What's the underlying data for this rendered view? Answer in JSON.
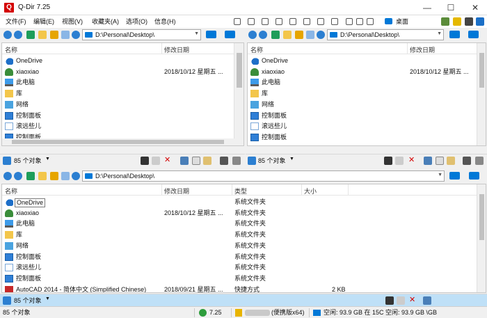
{
  "window": {
    "title": "Q-Dir 7.25",
    "app_icon_glyph": "Q",
    "controls": {
      "minimize": "—",
      "maximize": "☐",
      "close": "✕"
    }
  },
  "menu": [
    "文件(F)",
    "编辑(E)",
    "视图(V)",
    "收藏夹(A)",
    "选项(O)",
    "信息(H)"
  ],
  "menu_right": {
    "desktop_label": "桌面"
  },
  "panes": {
    "top_left": {
      "address": "D:\\Personal\\Desktop\\",
      "columns": [
        "名称",
        "修改日期"
      ],
      "rows": [
        {
          "name": "OneDrive",
          "date": "",
          "icon": "onedrive-icon"
        },
        {
          "name": "xiaoxiao",
          "date": "2018/10/12 星期五 ...",
          "icon": "user-icon"
        },
        {
          "name": "此电脑",
          "date": "",
          "icon": "computer-icon"
        },
        {
          "name": "库",
          "date": "",
          "icon": "library-icon"
        },
        {
          "name": "网络",
          "date": "",
          "icon": "network-icon"
        },
        {
          "name": "控制面板",
          "date": "",
          "icon": "control-panel-icon"
        },
        {
          "name": "滚远些儿",
          "date": "",
          "icon": "sync-icon"
        },
        {
          "name": "控制面板",
          "date": "",
          "icon": "control-panel-icon"
        }
      ],
      "count": "85 个对象"
    },
    "top_right": {
      "address": "D:\\Personal\\Desktop\\",
      "columns": [
        "名称",
        "修改日期"
      ],
      "rows": [
        {
          "name": "OneDrive",
          "date": "",
          "icon": "onedrive-icon"
        },
        {
          "name": "xiaoxiao",
          "date": "2018/10/12 星期五 ...",
          "icon": "user-icon"
        },
        {
          "name": "此电脑",
          "date": "",
          "icon": "computer-icon"
        },
        {
          "name": "库",
          "date": "",
          "icon": "library-icon"
        },
        {
          "name": "网络",
          "date": "",
          "icon": "network-icon"
        },
        {
          "name": "控制面板",
          "date": "",
          "icon": "control-panel-icon"
        },
        {
          "name": "滚远些儿",
          "date": "",
          "icon": "sync-icon"
        },
        {
          "name": "控制面板",
          "date": "",
          "icon": "control-panel-icon"
        }
      ],
      "count": "85 个对象"
    },
    "bottom": {
      "address": "D:\\Personal\\Desktop\\",
      "columns": [
        "名称",
        "修改日期",
        "类型",
        "大小"
      ],
      "rows": [
        {
          "name": "OneDrive",
          "date": "",
          "type": "系统文件夹",
          "size": "",
          "icon": "onedrive-icon"
        },
        {
          "name": "xiaoxiao",
          "date": "2018/10/12 星期五 ...",
          "type": "系统文件夹",
          "size": "",
          "icon": "user-icon"
        },
        {
          "name": "此电脑",
          "date": "",
          "type": "系统文件夹",
          "size": "",
          "icon": "computer-icon"
        },
        {
          "name": "库",
          "date": "",
          "type": "系统文件夹",
          "size": "",
          "icon": "library-icon"
        },
        {
          "name": "网络",
          "date": "",
          "type": "系统文件夹",
          "size": "",
          "icon": "network-icon"
        },
        {
          "name": "控制面板",
          "date": "",
          "type": "系统文件夹",
          "size": "",
          "icon": "control-panel-icon"
        },
        {
          "name": "滚远些儿",
          "date": "",
          "type": "系统文件夹",
          "size": "",
          "icon": "sync-icon"
        },
        {
          "name": "控制面板",
          "date": "",
          "type": "系统文件夹",
          "size": "",
          "icon": "control-panel-icon"
        },
        {
          "name": "AutoCAD 2014 - 简体中文 (Simplified Chinese)",
          "date": "2018/09/21 星期五 ...",
          "type": "快捷方式",
          "size": "2 KB",
          "icon": "autocad-icon"
        }
      ],
      "count": "85 个对象"
    }
  },
  "statusbar": {
    "objects": "85 个对象",
    "version": "7.25",
    "edition": "(便携版x64)",
    "disk_info": "空闲: 93.9 GB 在 15C 空闲: 93.9 GB \\GB"
  },
  "colors": {
    "accent": "#0078d7",
    "close_red": "#d40000",
    "footer_blue": "#bfe0f7"
  }
}
